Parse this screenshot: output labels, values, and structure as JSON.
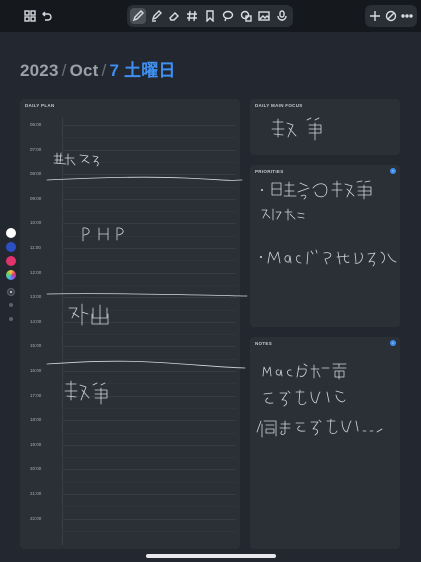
{
  "toolbar": {
    "left_icons": [
      "apps-grid-icon",
      "undo-icon"
    ],
    "tools": [
      "pen-icon",
      "highlighter-icon",
      "eraser-icon",
      "hashtag-icon",
      "bookmark-icon",
      "lasso-icon",
      "shapes-icon",
      "image-icon",
      "microphone-icon"
    ],
    "right_icons": [
      "add-icon",
      "no-hide-icon",
      "more-icon"
    ],
    "active_tool": "pen-icon"
  },
  "header": {
    "year": "2023",
    "sep1": "/",
    "month": "Oct",
    "sep2": "/",
    "day": "7 土曜日"
  },
  "daily_plan": {
    "title": "DAILY PLAN",
    "hours": [
      "06:00",
      "07:00",
      "08:00",
      "09:00",
      "10:00",
      "11:00",
      "12:00",
      "13:00",
      "14:00",
      "15:00",
      "16:00",
      "17:00",
      "18:00",
      "19:00",
      "20:00",
      "21:00",
      "22:00"
    ]
  },
  "daily_main_focus": {
    "title": "DAILY MAIN FOCUS"
  },
  "priorities": {
    "title": "PRIORITIES"
  },
  "notes": {
    "title": "NOTES"
  },
  "palette": {
    "colors": [
      "#ffffff",
      "#2d4fc4",
      "#e0336b",
      "#c9a8e8"
    ]
  },
  "handwriting": {
    "plan_0700": "起きる",
    "plan_1000": "PHP",
    "plan_1400": "外出",
    "plan_1700": "執筆",
    "focus": "執筆",
    "priority_1": "日本語の執筆 締め",
    "priority_2": "Macどうにかする",
    "notes_1": "Macが起電",
    "notes_2": "できないと",
    "notes_3": "何もできない…"
  }
}
